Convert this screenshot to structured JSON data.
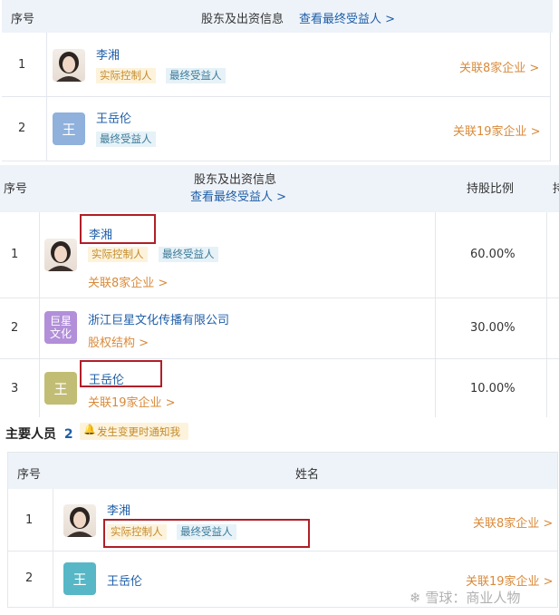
{
  "panel1": {
    "col_index": "序号",
    "col_shareholder": "股东及出资信息",
    "view_beneficiary": "查看最终受益人 >",
    "rows": [
      {
        "index": "1",
        "name": "李湘",
        "tags": [
          "实际控制人",
          "最终受益人"
        ],
        "related": "关联8家企业 >"
      },
      {
        "index": "2",
        "avatar_char": "王",
        "name": "王岳伦",
        "tags": [
          "最终受益人"
        ],
        "related": "关联19家企业 >"
      }
    ]
  },
  "panel2": {
    "col_index": "序号",
    "col_shareholder": "股东及出资信息",
    "view_beneficiary": "查看最终受益人 >",
    "col_ratio": "持股比例",
    "col_more": "持",
    "rows": [
      {
        "index": "1",
        "name": "李湘",
        "tags": [
          "实际控制人",
          "最终受益人"
        ],
        "related": "关联8家企业 >",
        "ratio": "60.00%"
      },
      {
        "index": "2",
        "avatar_char": "巨星\n文化",
        "name": "浙江巨星文化传播有限公司",
        "related": "股权结构 >",
        "ratio": "30.00%"
      },
      {
        "index": "3",
        "avatar_char": "王",
        "name": "王岳伦",
        "related": "关联19家企业 >",
        "ratio": "10.00%"
      }
    ]
  },
  "personnel": {
    "title": "主要人员",
    "count": "2",
    "notify": "发生变更时通知我",
    "col_index": "序号",
    "col_name": "姓名",
    "rows": [
      {
        "index": "1",
        "name": "李湘",
        "tags": [
          "实际控制人",
          "最终受益人"
        ],
        "related": "关联8家企业 >"
      },
      {
        "index": "2",
        "avatar_char": "王",
        "name": "王岳伦",
        "related": "关联19家企业 >"
      }
    ]
  },
  "watermark": {
    "text": "雪球：商业人物",
    "icon": "snowball-logo"
  },
  "colors": {
    "header_bg": "#eef3f9",
    "link_blue": "#1f5fa8",
    "link_orange": "#d98a3a",
    "highlight_red": "#b01f28",
    "avatar_blue": "#8fb1dc",
    "avatar_purple": "#b28fd9",
    "avatar_olive": "#c2bd74",
    "avatar_teal": "#57b7c6"
  }
}
